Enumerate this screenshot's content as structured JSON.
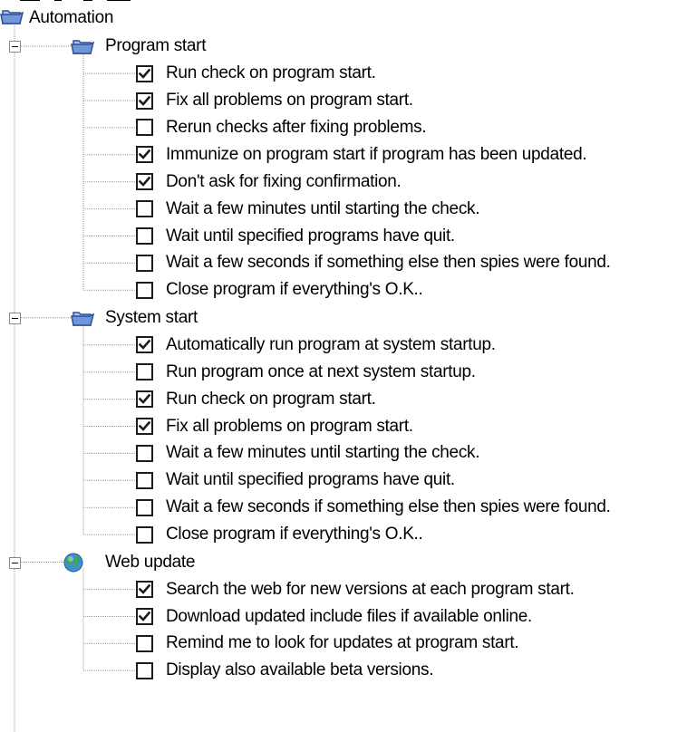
{
  "root": {
    "label": "Automation",
    "icon": "folder-icon"
  },
  "groups": [
    {
      "label": "Program start",
      "icon": "folder-icon",
      "items": [
        {
          "label": "Run check on program start.",
          "checked": true
        },
        {
          "label": "Fix all problems on program start.",
          "checked": true
        },
        {
          "label": "Rerun checks after fixing problems.",
          "checked": false
        },
        {
          "label": "Immunize on program start if program has been updated.",
          "checked": true
        },
        {
          "label": "Don't ask for fixing confirmation.",
          "checked": true
        },
        {
          "label": "Wait a few minutes until starting the check.",
          "checked": false
        },
        {
          "label": "Wait until specified programs have quit.",
          "checked": false
        },
        {
          "label": "Wait a few seconds if something else then spies were found.",
          "checked": false
        },
        {
          "label": "Close program if everything's O.K..",
          "checked": false
        }
      ]
    },
    {
      "label": "System start",
      "icon": "folder-icon",
      "items": [
        {
          "label": "Automatically run program at system startup.",
          "checked": true
        },
        {
          "label": "Run program once at next system startup.",
          "checked": false
        },
        {
          "label": "Run check on program start.",
          "checked": true
        },
        {
          "label": "Fix all problems on program start.",
          "checked": true
        },
        {
          "label": "Wait a few minutes until starting the check.",
          "checked": false
        },
        {
          "label": "Wait until specified programs have quit.",
          "checked": false
        },
        {
          "label": "Wait a few seconds if something else then spies were found.",
          "checked": false
        },
        {
          "label": "Close program if everything's O.K..",
          "checked": false
        }
      ]
    },
    {
      "label": "Web update",
      "icon": "globe-icon",
      "items": [
        {
          "label": "Search the web for new versions at each program start.",
          "checked": true
        },
        {
          "label": "Download updated include files if available online.",
          "checked": true
        },
        {
          "label": "Remind me to look for updates at program start.",
          "checked": false
        },
        {
          "label": "Display also available beta versions.",
          "checked": false
        }
      ]
    }
  ],
  "colors": {
    "check": "#1c1c1c",
    "folder": "#4f79c7",
    "folderLight": "#a9c4ee",
    "tree_line": "#9a9a9a"
  }
}
